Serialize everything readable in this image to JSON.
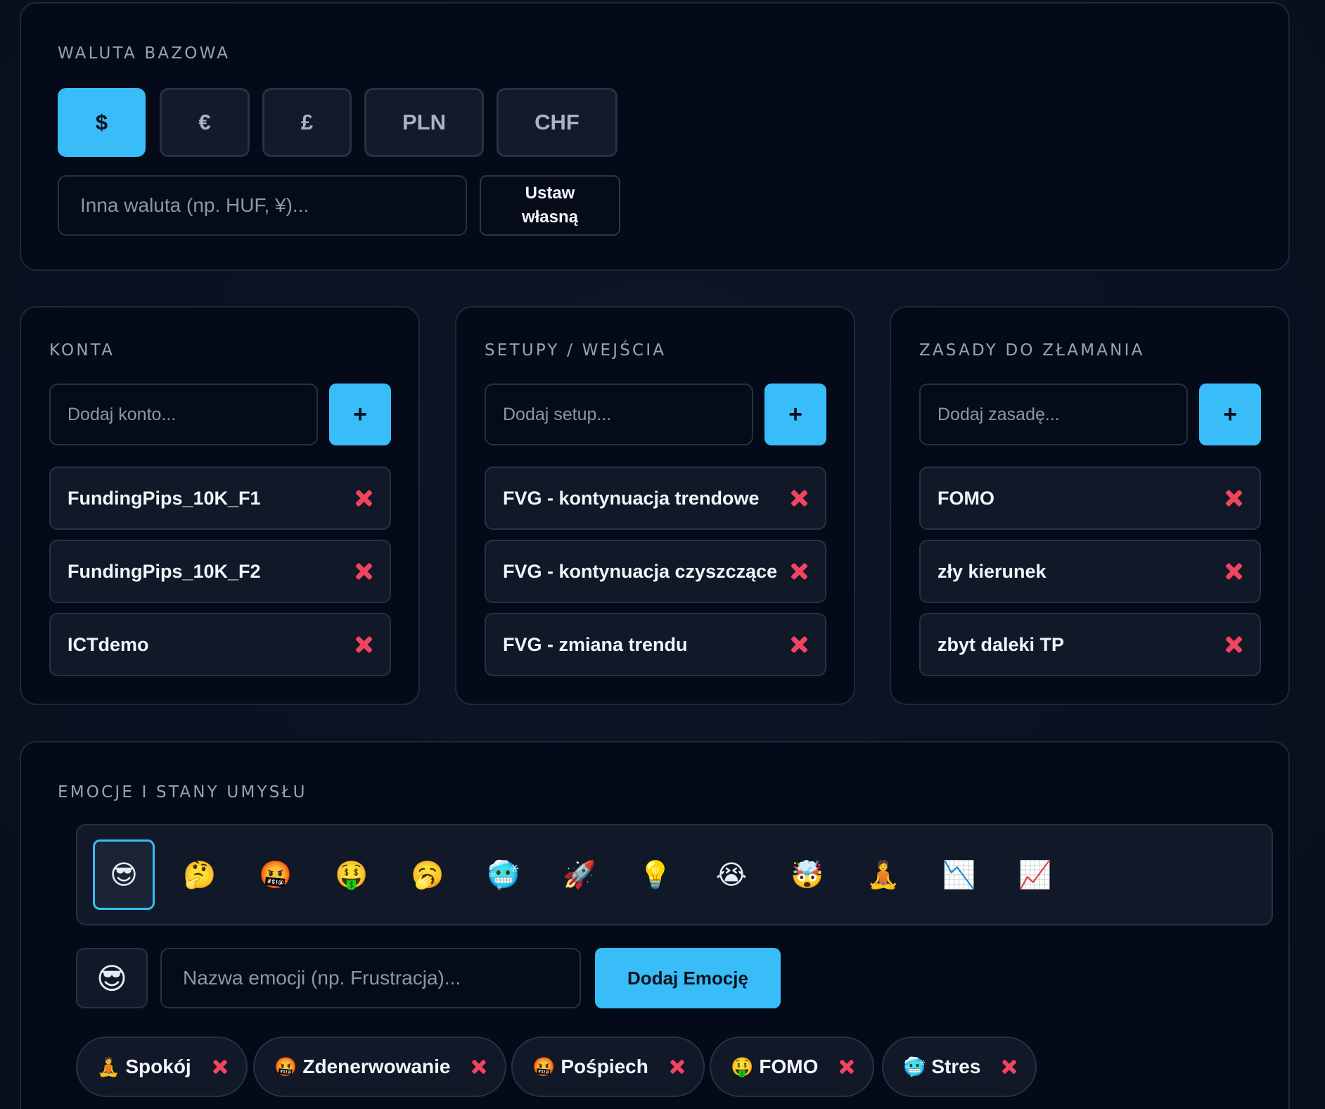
{
  "currency": {
    "title": "WALUTA BAZOWA",
    "options": [
      {
        "label": "$",
        "active": true
      },
      {
        "label": "€",
        "active": false
      },
      {
        "label": "£",
        "active": false
      },
      {
        "label": "PLN",
        "active": false
      },
      {
        "label": "CHF",
        "active": false
      }
    ],
    "custom_placeholder": "Inna waluta (np. HUF, ¥)...",
    "custom_value": "",
    "set_button_line1": "Ustaw",
    "set_button_line2": "własną"
  },
  "accounts": {
    "title": "KONTA",
    "placeholder": "Dodaj konto...",
    "add_label": "+",
    "items": [
      "FundingPips_10K_F1",
      "FundingPips_10K_F2",
      "ICTdemo"
    ]
  },
  "setups": {
    "title": "SETUPY / WEJŚCIA",
    "placeholder": "Dodaj setup...",
    "add_label": "+",
    "items": [
      "FVG - kontynuacja trendowe",
      "FVG - kontynuacja czyszczące",
      "FVG - zmiana trendu"
    ]
  },
  "rules": {
    "title": "ZASADY DO ZŁAMANIA",
    "placeholder": "Dodaj zasadę...",
    "add_label": "+",
    "items": [
      "FOMO",
      "zły kierunek",
      "zbyt daleki TP"
    ]
  },
  "emotions": {
    "title": "EMOCJE I STANY UMYSŁU",
    "picker": [
      {
        "emoji": "😎",
        "icon": "sunglasses-face-icon",
        "selected": true
      },
      {
        "emoji": "🤔",
        "icon": "thinking-face-icon",
        "selected": false
      },
      {
        "emoji": "🤬",
        "icon": "cursing-face-icon",
        "selected": false
      },
      {
        "emoji": "🤑",
        "icon": "money-mouth-face-icon",
        "selected": false
      },
      {
        "emoji": "🥱",
        "icon": "yawning-face-icon",
        "selected": false
      },
      {
        "emoji": "🥶",
        "icon": "cold-face-icon",
        "selected": false
      },
      {
        "emoji": "🚀",
        "icon": "rocket-icon",
        "selected": false
      },
      {
        "emoji": "💡",
        "icon": "light-bulb-icon",
        "selected": false
      },
      {
        "emoji": "😭",
        "icon": "crying-face-icon",
        "selected": false
      },
      {
        "emoji": "🤯",
        "icon": "exploding-head-icon",
        "selected": false
      },
      {
        "emoji": "🧘",
        "icon": "meditation-icon",
        "selected": false
      },
      {
        "emoji": "📉",
        "icon": "chart-decreasing-icon",
        "selected": false
      },
      {
        "emoji": "📈",
        "icon": "chart-increasing-icon",
        "selected": false
      }
    ],
    "current_emoji": "😎",
    "name_placeholder": "Nazwa emocji (np. Frustracja)...",
    "add_button": "Dodaj Emocję",
    "chips": [
      {
        "emoji": "🧘",
        "label": "Spokój"
      },
      {
        "emoji": "🤬",
        "label": "Zdenerwowanie"
      },
      {
        "emoji": "🤬",
        "label": "Pośpiech"
      },
      {
        "emoji": "🤑",
        "label": "FOMO"
      },
      {
        "emoji": "🥶",
        "label": "Stres"
      }
    ]
  },
  "colors": {
    "accent": "#38bdf8",
    "delete": "#f0445f",
    "card_bg": "#040a18",
    "page_bg": "#0b1221"
  }
}
